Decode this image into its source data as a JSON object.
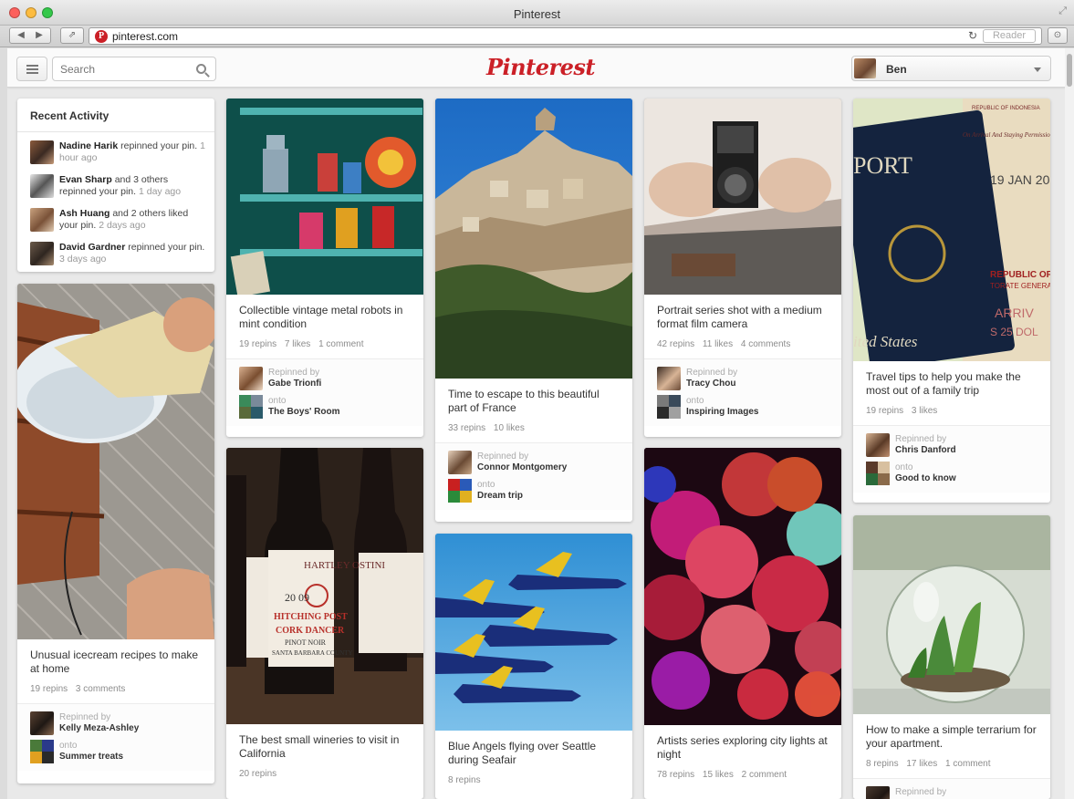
{
  "window": {
    "title": "Pinterest",
    "url": "pinterest.com",
    "reader_label": "Reader"
  },
  "header": {
    "logo": "Pinterest",
    "search_placeholder": "Search",
    "user_name": "Ben"
  },
  "recent_activity": {
    "title": "Recent Activity",
    "items": [
      {
        "name": "Nadine Harik",
        "text": " repinned your pin.",
        "time": " 1 hour ago"
      },
      {
        "name": "Evan Sharp",
        "text": " and 3 others repinned your pin.",
        "time": " 1 day ago"
      },
      {
        "name": "Ash Huang",
        "text": " and 2 others liked your pin.",
        "time": " 2 days ago"
      },
      {
        "name": "David Gardner",
        "text": " repinned your pin.",
        "time": " 3 days ago"
      }
    ]
  },
  "labels": {
    "repinned_by": "Repinned by",
    "onto": "onto"
  },
  "pins": {
    "icecream": {
      "desc": "Unusual icecream recipes to make at home",
      "stats": [
        "19 repins",
        "3 comments"
      ],
      "repinner": "Kelly Meza-Ashley",
      "board": "Summer treats"
    },
    "robots": {
      "desc": "Collectible vintage metal robots in mint condition",
      "stats": [
        "19 repins",
        "7 likes",
        "1 comment"
      ],
      "repinner": "Gabe Trionfi",
      "board": "The Boys' Room"
    },
    "wineries": {
      "desc": "The best small wineries to visit in California",
      "stats": [
        "20 repins"
      ],
      "bottle_top": "HARTLEY OSTINI",
      "bottle_year": "20  09",
      "bottle_brand": "HITCHING POST",
      "bottle_name": "CORK DANCER",
      "bottle_variety": "PINOT NOIR",
      "bottle_county": "SANTA BARBARA COUNTY"
    },
    "france": {
      "desc": "Time to escape to this beautiful part of France",
      "stats": [
        "33 repins",
        "10 likes"
      ],
      "repinner": "Connor Montgomery",
      "board": "Dream trip"
    },
    "blueangels": {
      "desc": "Blue Angels flying over Seattle during Seafair",
      "stats": [
        "8 repins"
      ]
    },
    "camera": {
      "desc": "Portrait series shot with a medium format film camera",
      "stats": [
        "42 repins",
        "11 likes",
        "4 comments"
      ],
      "repinner": "Tracy Chou",
      "board": "Inspiring Images"
    },
    "citylights": {
      "desc": "Artists series exploring city lights at night",
      "stats": [
        "78 repins",
        "15 likes",
        "2 comment"
      ]
    },
    "travel": {
      "desc": "Travel tips to help you make the most out of a family trip",
      "stats": [
        "19 repins",
        "3 likes"
      ],
      "repinner": "Chris Danford",
      "board": "Good to know",
      "passport_word": "PORT",
      "passport_states": "ited States",
      "visa_header": "REPUBLIC OF INDONESIA",
      "visa_arrival": "On Arrival And Staying Permission",
      "visa_date": "19 JAN 20",
      "visa_republic": "REPUBLIC OF I",
      "visa_torate": "TORATE GENERA",
      "visa_arriv": "ARRIV",
      "visa_dol": "S 25 DOL"
    },
    "terrarium": {
      "desc": "How to make a simple terrarium for your apartment.",
      "stats": [
        "8 repins",
        "17 likes",
        "1 comment"
      ]
    }
  }
}
